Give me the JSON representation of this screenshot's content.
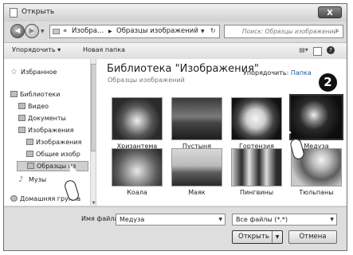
{
  "window": {
    "title": "Открыть",
    "close_label": "X"
  },
  "nav": {
    "back_glyph": "◀",
    "fwd_glyph": "▶",
    "address": {
      "prefix": "«",
      "segment1": "Изобра...",
      "sep": "▶",
      "segment2": "Образцы изображений",
      "dropdown": "▼",
      "refresh": "↻"
    },
    "search_placeholder": "Поиск: Образцы изображений"
  },
  "toolbar": {
    "organize": "Упорядочить ▾",
    "new_folder": "Новая папка"
  },
  "sidebar": {
    "items": [
      {
        "label": "Избранное"
      },
      {
        "label": "Библиотеки"
      },
      {
        "label": "Видео"
      },
      {
        "label": "Документы"
      },
      {
        "label": "Изображения"
      },
      {
        "label": "Изображения"
      },
      {
        "label": "Общие изобр"
      },
      {
        "label": "Образцы из"
      },
      {
        "label": "Музы"
      },
      {
        "label": "Домашняя группа"
      }
    ]
  },
  "library": {
    "title": "Библиотека \"Изображения\"",
    "subtitle": "Образцы изображений",
    "arrange_label": "Упорядочить:",
    "arrange_value": "Папка"
  },
  "thumbnails": [
    {
      "label": "Хризантема"
    },
    {
      "label": "Пустыня"
    },
    {
      "label": "Гортензия"
    },
    {
      "label": "Медуза"
    },
    {
      "label": "Коала"
    },
    {
      "label": "Маяк"
    },
    {
      "label": "Пингвины"
    },
    {
      "label": "Тюльпаны"
    }
  ],
  "step_badge": "2",
  "bottom": {
    "filename_label": "Имя файла:",
    "filename_value": "Медуза",
    "filter_value": "Все файлы (*.*)",
    "open_label": "Открыть",
    "cancel_label": "Отмена"
  }
}
